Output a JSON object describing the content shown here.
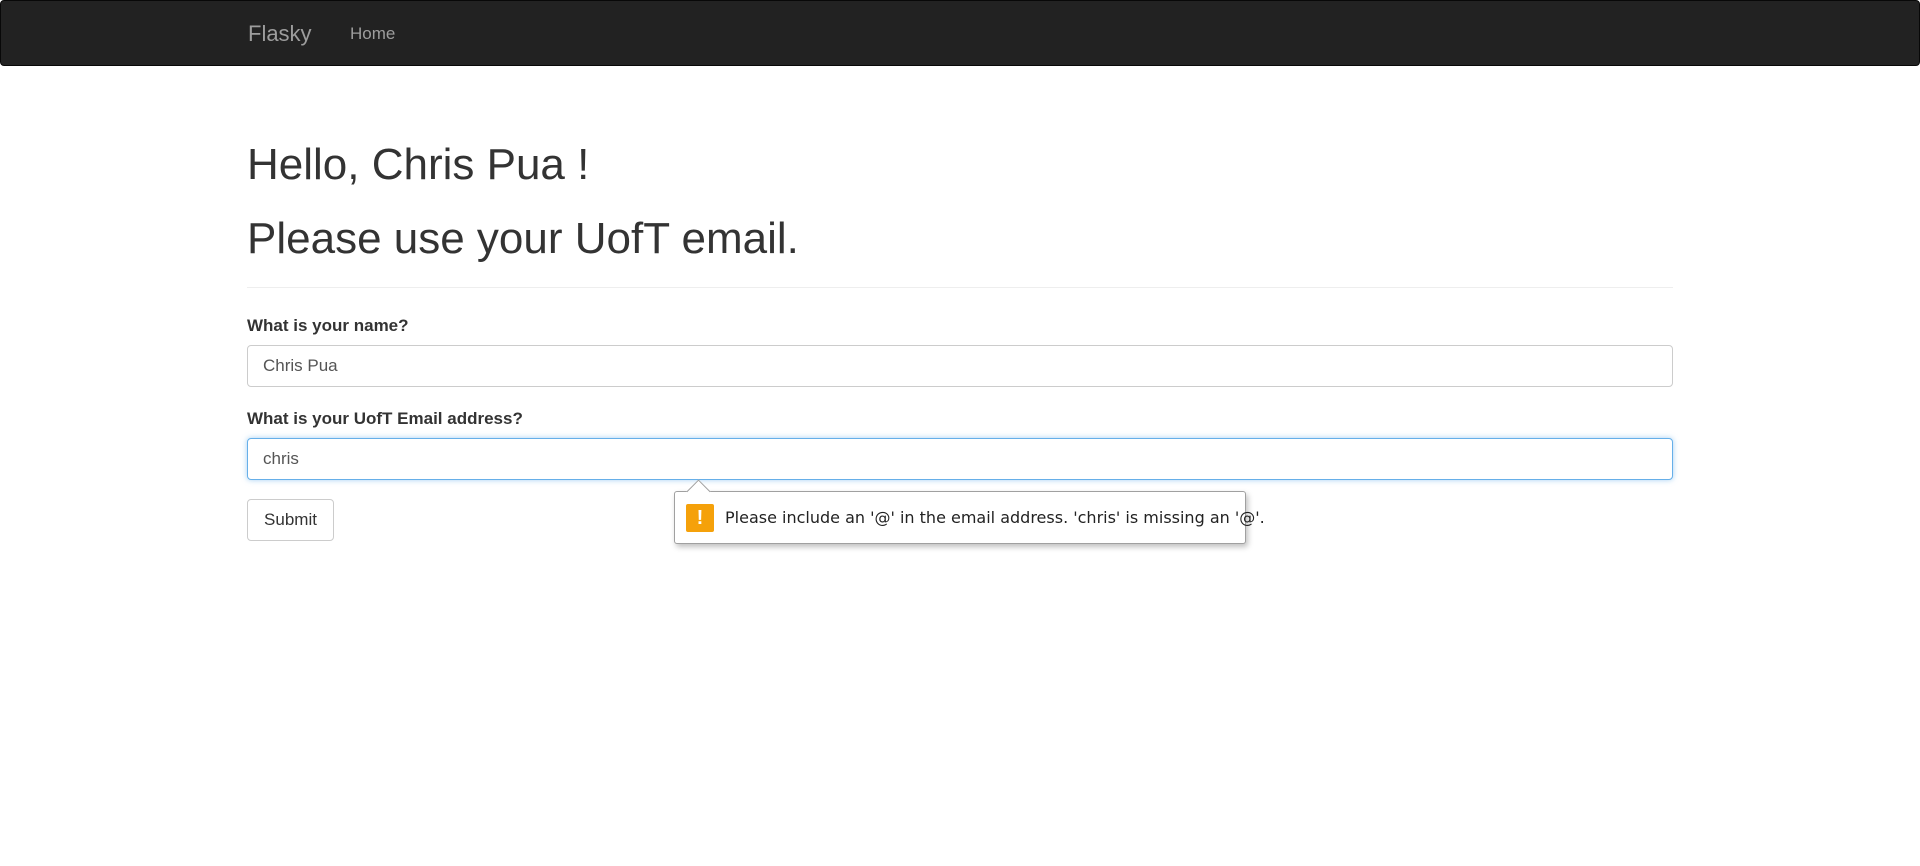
{
  "navbar": {
    "brand": "Flasky",
    "items": [
      {
        "label": "Home"
      }
    ]
  },
  "main": {
    "greeting": "Hello, Chris Pua !",
    "notice": "Please use your UofT email."
  },
  "form": {
    "name_label": "What is your name?",
    "name_value": "Chris Pua",
    "email_label": "What is your UofT Email address?",
    "email_value": "chris",
    "submit_label": "Submit"
  },
  "validation_tooltip": {
    "icon": "warning-icon",
    "message": "Please include an '@' in the email address. 'chris' is missing an '@'.",
    "accent_color": "#f5a10a"
  }
}
